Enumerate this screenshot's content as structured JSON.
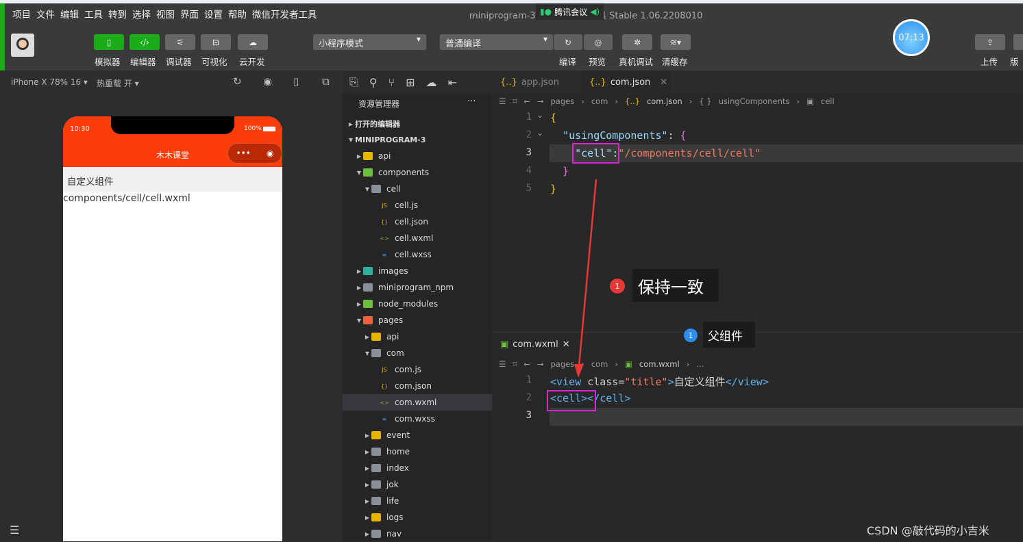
{
  "menu": [
    "项目",
    "文件",
    "编辑",
    "工具",
    "转到",
    "选择",
    "视图",
    "界面",
    "设置",
    "帮助",
    "微信开发者工具"
  ],
  "window_title": "miniprogram-3 · 微信开发者工具 Stable 1.06.2208010",
  "meeting": "腾讯会议",
  "toolbar": {
    "buttons": [
      "模拟器",
      "编辑器",
      "调试器",
      "可视化",
      "云开发"
    ],
    "mode": "小程序模式",
    "compile_mode": "普通编译",
    "actions": [
      "编译",
      "预览",
      "真机调试",
      "清缓存"
    ],
    "clock": "07:13",
    "right": [
      "上传",
      "版本"
    ]
  },
  "simulator": {
    "device": "iPhone X 78% 16 ▾",
    "hot_reload": "热重载 开 ▾",
    "time": "10:30",
    "battery": "100%",
    "nav_title": "木木课堂",
    "page_title": "自定义组件",
    "page_body": "components/cell/cell.wxml"
  },
  "explorer": {
    "title": "资源管理器",
    "more": "···",
    "open_editors": "打开的编辑器",
    "project": "MINIPROGRAM-3",
    "items": [
      {
        "label": "api",
        "level": 1,
        "type": "folder-yellow"
      },
      {
        "label": "components",
        "level": 1,
        "type": "folder-green",
        "open": true
      },
      {
        "label": "cell",
        "level": 2,
        "type": "folder",
        "open": true
      },
      {
        "label": "cell.js",
        "level": 3,
        "type": "js"
      },
      {
        "label": "cell.json",
        "level": 3,
        "type": "json"
      },
      {
        "label": "cell.wxml",
        "level": 3,
        "type": "wxml"
      },
      {
        "label": "cell.wxss",
        "level": 3,
        "type": "wxss"
      },
      {
        "label": "images",
        "level": 1,
        "type": "folder-teal"
      },
      {
        "label": "miniprogram_npm",
        "level": 1,
        "type": "folder"
      },
      {
        "label": "node_modules",
        "level": 1,
        "type": "folder-green"
      },
      {
        "label": "pages",
        "level": 1,
        "type": "folder-red",
        "open": true
      },
      {
        "label": "api",
        "level": 2,
        "type": "folder-yellow"
      },
      {
        "label": "com",
        "level": 2,
        "type": "folder",
        "open": true
      },
      {
        "label": "com.js",
        "level": 3,
        "type": "js"
      },
      {
        "label": "com.json",
        "level": 3,
        "type": "json"
      },
      {
        "label": "com.wxml",
        "level": 3,
        "type": "wxml",
        "selected": true
      },
      {
        "label": "com.wxss",
        "level": 3,
        "type": "wxss"
      },
      {
        "label": "event",
        "level": 2,
        "type": "folder-yellow"
      },
      {
        "label": "home",
        "level": 2,
        "type": "folder"
      },
      {
        "label": "index",
        "level": 2,
        "type": "folder"
      },
      {
        "label": "jok",
        "level": 2,
        "type": "folder"
      },
      {
        "label": "life",
        "level": 2,
        "type": "folder"
      },
      {
        "label": "logs",
        "level": 2,
        "type": "folder-yellow"
      },
      {
        "label": "nav",
        "level": 2,
        "type": "folder"
      }
    ]
  },
  "editor_top": {
    "tabs": [
      "app.json",
      "com.json"
    ],
    "breadcrumb": [
      "pages",
      "com",
      "com.json",
      "usingComponents",
      "cell"
    ],
    "lines": [
      "1",
      "2",
      "3",
      "4",
      "5"
    ]
  },
  "editor_bottom": {
    "tab": "com.wxml",
    "breadcrumb": [
      "pages",
      "com",
      "com.wxml",
      "..."
    ],
    "lines": [
      "1",
      "2",
      "3"
    ]
  },
  "annotations": {
    "keep_consistent": "保持一致",
    "parent": "父组件",
    "num": "1"
  },
  "watermark": "CSDN @敲代码的小吉米",
  "colors": {
    "accent": "#1aad19",
    "nav": "#fa3c0a",
    "highlight": "#e020e0",
    "arrow": "#e53935"
  }
}
